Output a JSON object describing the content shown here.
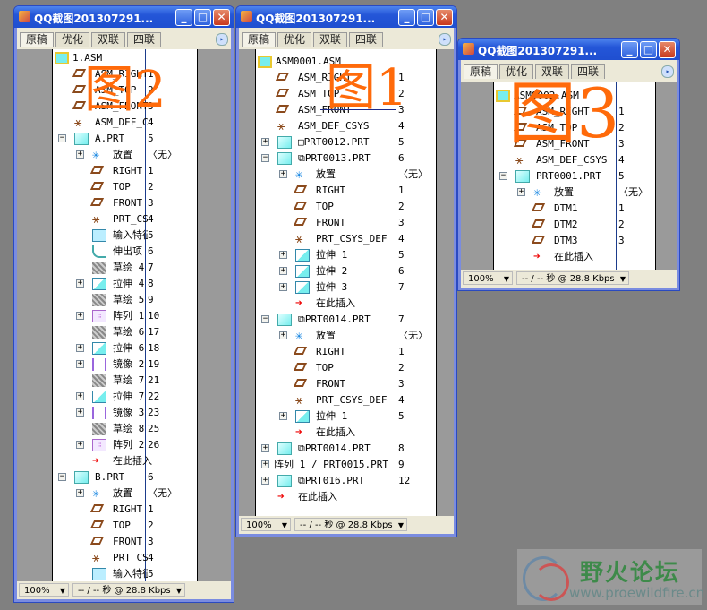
{
  "window_title": "QQ截图201307291...",
  "tabs": [
    "原稿",
    "优化",
    "双联",
    "四联"
  ],
  "status": {
    "zoom": "100%",
    "rate": "-- / -- 秒 @ 28.8 Kbps"
  },
  "overlays": {
    "w1": "图2",
    "w2": "图1",
    "w3": "图3"
  },
  "watermark": {
    "name": "野火论坛",
    "url": "www.proewildfire.cn"
  },
  "windows": [
    {
      "id": "w1",
      "rows": [
        {
          "l": 0,
          "i": "asm",
          "t": "1.ASM",
          "n": ""
        },
        {
          "l": 1,
          "i": "plane",
          "t": "ASM_RIGHT",
          "n": "1"
        },
        {
          "l": 1,
          "i": "plane",
          "t": "ASM_TOP",
          "n": "2"
        },
        {
          "l": 1,
          "i": "plane",
          "t": "ASM_FRONT",
          "n": "3"
        },
        {
          "l": 1,
          "i": "csys",
          "t": "ASM_DEF_CS",
          "n": "4"
        },
        {
          "l": 1,
          "i": "part",
          "t": "A.PRT",
          "n": "5",
          "e": "-"
        },
        {
          "l": 2,
          "i": "place",
          "t": "放置",
          "n": "〈无〉",
          "e": "+"
        },
        {
          "l": 2,
          "i": "plane",
          "t": "RIGHT",
          "n": "1"
        },
        {
          "l": 2,
          "i": "plane",
          "t": "TOP",
          "n": "2"
        },
        {
          "l": 2,
          "i": "plane",
          "t": "FRONT",
          "n": "3"
        },
        {
          "l": 2,
          "i": "csys",
          "t": "PRT_CSY",
          "n": "4"
        },
        {
          "l": 2,
          "i": "input",
          "t": "输入特征",
          "n": "5"
        },
        {
          "l": 2,
          "i": "protr",
          "t": "伸出项",
          "n": "6"
        },
        {
          "l": 2,
          "i": "sketch",
          "t": "草绘 4",
          "n": "7"
        },
        {
          "l": 2,
          "i": "ext",
          "t": "拉伸 4",
          "n": "8",
          "e": "+"
        },
        {
          "l": 2,
          "i": "sketch",
          "t": "草绘 5",
          "n": "9"
        },
        {
          "l": 2,
          "i": "pattern",
          "t": "阵列 1",
          "n": "10",
          "e": "+"
        },
        {
          "l": 2,
          "i": "sketch",
          "t": "草绘 6",
          "n": "17"
        },
        {
          "l": 2,
          "i": "ext",
          "t": "拉伸 6",
          "n": "18",
          "e": "+"
        },
        {
          "l": 2,
          "i": "mirror",
          "t": "镜像 2",
          "n": "19",
          "e": "+"
        },
        {
          "l": 2,
          "i": "sketch",
          "t": "草绘 7",
          "n": "21"
        },
        {
          "l": 2,
          "i": "ext",
          "t": "拉伸 7",
          "n": "22",
          "e": "+"
        },
        {
          "l": 2,
          "i": "mirror",
          "t": "镜像 3",
          "n": "23",
          "e": "+"
        },
        {
          "l": 2,
          "i": "sketch",
          "t": "草绘 8",
          "n": "25"
        },
        {
          "l": 2,
          "i": "pattern",
          "t": "阵列 2",
          "n": "26",
          "e": "+"
        },
        {
          "l": 2,
          "i": "insert",
          "t": "在此插入",
          "n": ""
        },
        {
          "l": 1,
          "i": "part",
          "t": "B.PRT",
          "n": "6",
          "e": "-"
        },
        {
          "l": 2,
          "i": "place",
          "t": "放置",
          "n": "〈无〉",
          "e": "+"
        },
        {
          "l": 2,
          "i": "plane",
          "t": "RIGHT",
          "n": "1"
        },
        {
          "l": 2,
          "i": "plane",
          "t": "TOP",
          "n": "2"
        },
        {
          "l": 2,
          "i": "plane",
          "t": "FRONT",
          "n": "3"
        },
        {
          "l": 2,
          "i": "csys",
          "t": "PRT_CSY",
          "n": "4"
        },
        {
          "l": 2,
          "i": "input",
          "t": "输入特征",
          "n": "5"
        }
      ]
    },
    {
      "id": "w2",
      "rows": [
        {
          "l": 0,
          "i": "asm",
          "t": "ASM0001.ASM",
          "n": ""
        },
        {
          "l": 1,
          "i": "plane",
          "t": "ASM_RIGHT",
          "n": "1"
        },
        {
          "l": 1,
          "i": "plane",
          "t": "ASM_TOP",
          "n": "2"
        },
        {
          "l": 1,
          "i": "plane",
          "t": "ASM_FRONT",
          "n": "3"
        },
        {
          "l": 1,
          "i": "csys",
          "t": "ASM_DEF_CSYS",
          "n": "4"
        },
        {
          "l": 1,
          "i": "part",
          "t": "□PRT0012.PRT",
          "n": "5",
          "e": "+"
        },
        {
          "l": 1,
          "i": "part",
          "t": "⧉PRT0013.PRT",
          "n": "6",
          "e": "-"
        },
        {
          "l": 2,
          "i": "place",
          "t": "放置",
          "n": "〈无〉",
          "e": "+"
        },
        {
          "l": 2,
          "i": "plane",
          "t": "RIGHT",
          "n": "1"
        },
        {
          "l": 2,
          "i": "plane",
          "t": "TOP",
          "n": "2"
        },
        {
          "l": 2,
          "i": "plane",
          "t": "FRONT",
          "n": "3"
        },
        {
          "l": 2,
          "i": "csys",
          "t": "PRT_CSYS_DEF",
          "n": "4"
        },
        {
          "l": 2,
          "i": "ext",
          "t": "拉伸 1",
          "n": "5",
          "e": "+"
        },
        {
          "l": 2,
          "i": "ext",
          "t": "拉伸 2",
          "n": "6",
          "e": "+"
        },
        {
          "l": 2,
          "i": "ext",
          "t": "拉伸 3",
          "n": "7",
          "e": "+"
        },
        {
          "l": 2,
          "i": "insert",
          "t": "在此插入",
          "n": ""
        },
        {
          "l": 1,
          "i": "part",
          "t": "⧉PRT0014.PRT",
          "n": "7",
          "e": "-"
        },
        {
          "l": 2,
          "i": "place",
          "t": "放置",
          "n": "〈无〉",
          "e": "+"
        },
        {
          "l": 2,
          "i": "plane",
          "t": "RIGHT",
          "n": "1"
        },
        {
          "l": 2,
          "i": "plane",
          "t": "TOP",
          "n": "2"
        },
        {
          "l": 2,
          "i": "plane",
          "t": "FRONT",
          "n": "3"
        },
        {
          "l": 2,
          "i": "csys",
          "t": "PRT_CSYS_DEF",
          "n": "4"
        },
        {
          "l": 2,
          "i": "ext",
          "t": "拉伸 1",
          "n": "5",
          "e": "+"
        },
        {
          "l": 2,
          "i": "insert",
          "t": "在此插入",
          "n": ""
        },
        {
          "l": 1,
          "i": "part",
          "t": "⧉PRT0014.PRT",
          "n": "8",
          "e": "+"
        },
        {
          "l": 1,
          "i": "",
          "t": "阵列 1 / PRT0015.PRT",
          "n": "9",
          "e": "+"
        },
        {
          "l": 1,
          "i": "part",
          "t": "⧉PRT016.PRT",
          "n": "12",
          "e": "+"
        },
        {
          "l": 1,
          "i": "insert",
          "t": "在此插入",
          "n": ""
        }
      ]
    },
    {
      "id": "w3",
      "rows": [
        {
          "l": 0,
          "i": "asm",
          "t": "ASM0002.ASM",
          "n": ""
        },
        {
          "l": 1,
          "i": "plane",
          "t": "ASM_RIGHT",
          "n": "1"
        },
        {
          "l": 1,
          "i": "plane",
          "t": "ASM_TOP",
          "n": "2"
        },
        {
          "l": 1,
          "i": "plane",
          "t": "ASM_FRONT",
          "n": "3"
        },
        {
          "l": 1,
          "i": "csys",
          "t": "ASM_DEF_CSYS",
          "n": "4"
        },
        {
          "l": 1,
          "i": "part",
          "t": "PRT0001.PRT",
          "n": "5",
          "e": "-"
        },
        {
          "l": 2,
          "i": "place",
          "t": "放置",
          "n": "〈无〉",
          "e": "+"
        },
        {
          "l": 2,
          "i": "plane",
          "t": "DTM1",
          "n": "1"
        },
        {
          "l": 2,
          "i": "plane",
          "t": "DTM2",
          "n": "2"
        },
        {
          "l": 2,
          "i": "plane",
          "t": "DTM3",
          "n": "3"
        },
        {
          "l": 2,
          "i": "insert",
          "t": "在此插入",
          "n": ""
        }
      ]
    }
  ]
}
